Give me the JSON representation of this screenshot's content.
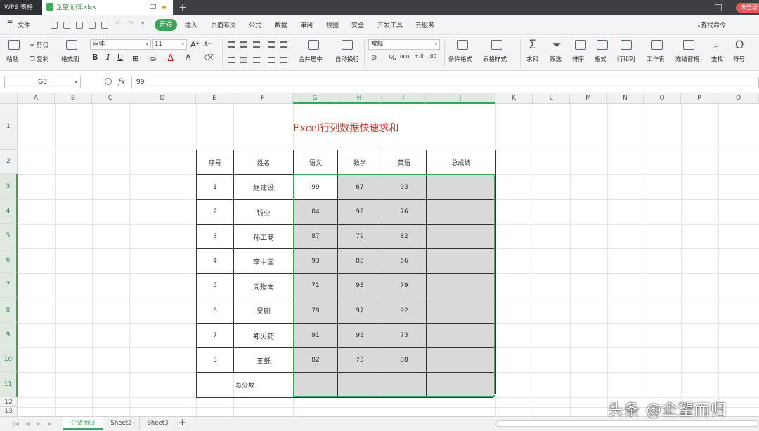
{
  "titlebar": {
    "app_tab": "WPS 表格",
    "file_tab": "企望而归.xlsx",
    "new_tab": "+",
    "login": "未登录"
  },
  "menubar": {
    "file": "文件",
    "items": [
      "开始",
      "插入",
      "页面布局",
      "公式",
      "数据",
      "审阅",
      "视图",
      "安全",
      "开发工具",
      "云服务"
    ],
    "search": "查找命令"
  },
  "ribbon": {
    "paste": "粘贴",
    "cut": "剪切",
    "copy": "复制",
    "format_painter": "格式刷",
    "font_name": "宋体",
    "font_size": "11",
    "bold": "B",
    "italic": "I",
    "underline": "U",
    "merge_center": "合并居中",
    "wrap_text": "自动换行",
    "number_format": "常规",
    "percent": "%",
    "cond_format": "条件格式",
    "table_style": "表格样式",
    "sum": "求和",
    "filter": "筛选",
    "sort": "排序",
    "format": "格式",
    "row_col": "行和列",
    "worksheet": "工作表",
    "freeze": "冻结窗格",
    "find": "查找",
    "symbol": "符号"
  },
  "formula_bar": {
    "cell_ref": "G3",
    "fx": "fx",
    "value": "99"
  },
  "columns": [
    "A",
    "B",
    "C",
    "D",
    "E",
    "F",
    "G",
    "H",
    "I",
    "J",
    "K",
    "L",
    "M",
    "N",
    "O",
    "P",
    "Q"
  ],
  "rows": [
    "1",
    "2",
    "3",
    "4",
    "5",
    "6",
    "7",
    "8",
    "9",
    "10",
    "11",
    "12",
    "13"
  ],
  "sheet": {
    "title": "Excel行列数据快速求和",
    "headers": [
      "序号",
      "姓名",
      "语文",
      "数学",
      "英语",
      "总成绩"
    ],
    "records": [
      {
        "id": "1",
        "name": "赵建设",
        "chinese": "99",
        "math": "67",
        "english": "93"
      },
      {
        "id": "2",
        "name": "钱业",
        "chinese": "84",
        "math": "92",
        "english": "76"
      },
      {
        "id": "3",
        "name": "孙工商",
        "chinese": "87",
        "math": "79",
        "english": "82"
      },
      {
        "id": "4",
        "name": "李中国",
        "chinese": "93",
        "math": "88",
        "english": "66"
      },
      {
        "id": "5",
        "name": "周指南",
        "chinese": "71",
        "math": "93",
        "english": "79"
      },
      {
        "id": "6",
        "name": "吴刷",
        "chinese": "79",
        "math": "97",
        "english": "92"
      },
      {
        "id": "7",
        "name": "郑火药",
        "chinese": "91",
        "math": "93",
        "english": "73"
      },
      {
        "id": "8",
        "name": "王纸",
        "chinese": "82",
        "math": "73",
        "english": "88"
      }
    ],
    "total_label": "总分数"
  },
  "sheet_tabs": [
    "企望而归",
    "Sheet2",
    "Sheet3"
  ],
  "watermark": "头条 @企望而归",
  "colors": {
    "accent": "#3ca55c",
    "title_red": "#c0392b",
    "shade": "#d9d9d9"
  }
}
